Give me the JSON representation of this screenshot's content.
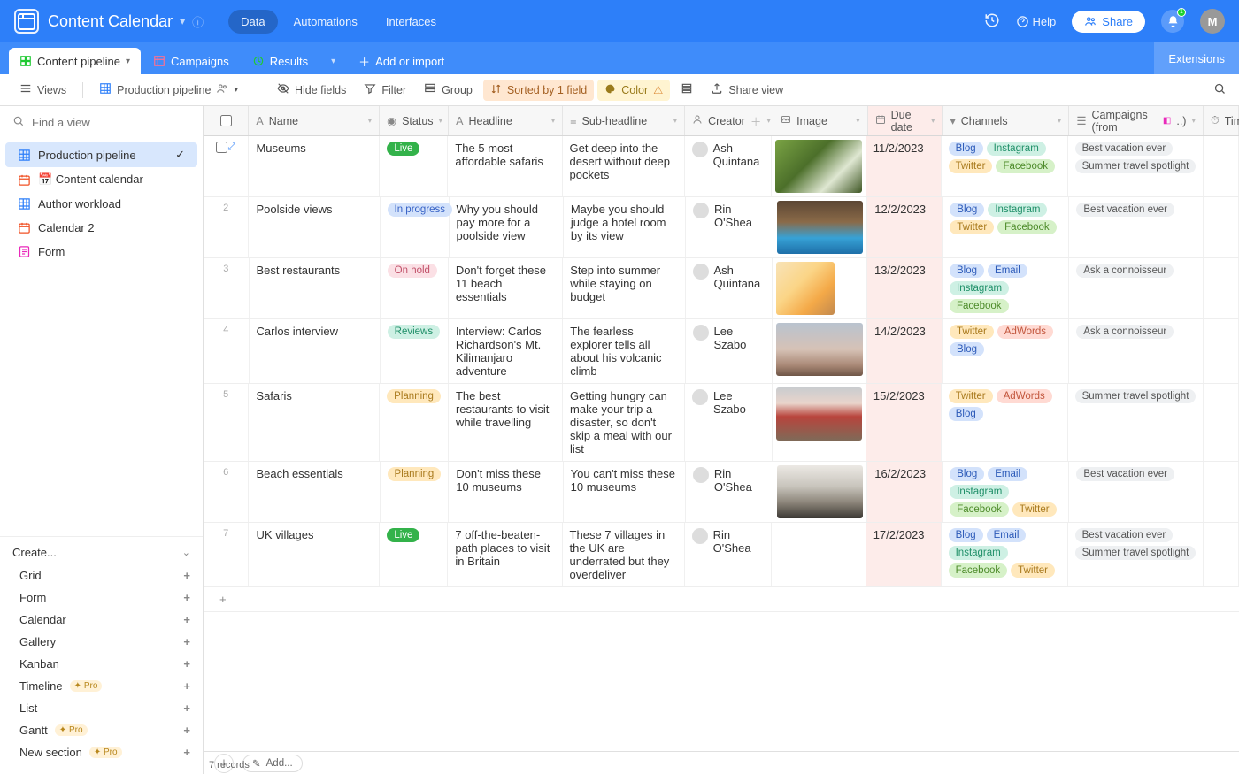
{
  "topbar": {
    "title": "Content Calendar",
    "tabs": {
      "data": "Data",
      "automations": "Automations",
      "interfaces": "Interfaces"
    },
    "help": "Help",
    "share": "Share",
    "avatar": "M",
    "notif_count": "1"
  },
  "tables": {
    "pipeline": "Content pipeline",
    "campaigns": "Campaigns",
    "results": "Results",
    "add": "Add or import",
    "extensions": "Extensions"
  },
  "toolbar": {
    "views": "Views",
    "currentView": "Production pipeline",
    "hide": "Hide fields",
    "filter": "Filter",
    "group": "Group",
    "sorted": "Sorted by 1 field",
    "color": "Color",
    "shareview": "Share view"
  },
  "sidebar": {
    "searchPlaceholder": "Find a view",
    "views": [
      {
        "label": "Production pipeline",
        "type": "grid",
        "active": true
      },
      {
        "label": "📅 Content calendar",
        "type": "cal"
      },
      {
        "label": "Author workload",
        "type": "grid"
      },
      {
        "label": "Calendar 2",
        "type": "cal"
      },
      {
        "label": "Form",
        "type": "form"
      }
    ],
    "create": "Create...",
    "types": [
      {
        "label": "Grid",
        "icon": "grid"
      },
      {
        "label": "Form",
        "icon": "form"
      },
      {
        "label": "Calendar",
        "icon": "cal"
      },
      {
        "label": "Gallery",
        "icon": "gal"
      },
      {
        "label": "Kanban",
        "icon": "kan"
      },
      {
        "label": "Timeline",
        "icon": "tl",
        "pro": true
      },
      {
        "label": "List",
        "icon": "list"
      },
      {
        "label": "Gantt",
        "icon": "gantt",
        "pro": true
      },
      {
        "label": "New section",
        "icon": "",
        "pro": true
      }
    ],
    "proLabel": "Pro"
  },
  "columns": {
    "name": "Name",
    "status": "Status",
    "headline": "Headline",
    "sub": "Sub-headline",
    "creator": "Creator",
    "image": "Image",
    "due": "Due date",
    "channels": "Channels",
    "campaigns": "Campaigns (from",
    "time": "Time"
  },
  "rows": [
    {
      "n": "",
      "name": "Museums",
      "status": "Live",
      "stClass": "st-live",
      "headline": "The 5 most affordable safaris",
      "sub": "Get deep into the desert without deep pockets",
      "creator": "Ash Quintana",
      "img": "img-safari",
      "due": "11/2/2023",
      "channels": [
        "Blog",
        "Instagram",
        "Twitter",
        "Facebook"
      ],
      "campaigns": [
        "Best vacation ever",
        "Summer travel spotlight"
      ]
    },
    {
      "n": "2",
      "name": "Poolside views",
      "status": "In progress",
      "stClass": "st-progress",
      "headline": "Why you should pay more for a poolside view",
      "sub": "Maybe you should judge a hotel room by its view",
      "creator": "Rin O'Shea",
      "img": "img-pool",
      "due": "12/2/2023",
      "channels": [
        "Blog",
        "Instagram",
        "Twitter",
        "Facebook"
      ],
      "campaigns": [
        "Best vacation ever"
      ]
    },
    {
      "n": "3",
      "name": "Best restaurants",
      "status": "On hold",
      "stClass": "st-hold",
      "headline": "Don't forget these 11 beach essentials",
      "sub": "Step into summer while staying on budget",
      "creator": "Ash Quintana",
      "img": "img-beach",
      "due": "13/2/2023",
      "channels": [
        "Blog",
        "Email",
        "Instagram",
        "Facebook"
      ],
      "campaigns": [
        "Ask a connoisseur"
      ]
    },
    {
      "n": "4",
      "name": "Carlos interview",
      "status": "Reviews",
      "stClass": "st-reviews",
      "headline": "Interview: Carlos Richardson's Mt. Kilimanjaro adventure",
      "sub": "The fearless explorer tells all about his volcanic climb",
      "creator": "Lee Szabo",
      "img": "img-mountain",
      "due": "14/2/2023",
      "channels": [
        "Twitter",
        "AdWords",
        "Blog"
      ],
      "campaigns": [
        "Ask a connoisseur"
      ]
    },
    {
      "n": "5",
      "name": "Safaris",
      "status": "Planning",
      "stClass": "st-planning",
      "headline": "The best restaurants to visit while travelling",
      "sub": "Getting hungry can make your trip a disaster, so don't skip a meal with our list",
      "creator": "Lee Szabo",
      "img": "img-rest",
      "due": "15/2/2023",
      "channels": [
        "Twitter",
        "AdWords",
        "Blog"
      ],
      "campaigns": [
        "Summer travel spotlight"
      ]
    },
    {
      "n": "6",
      "name": "Beach essentials",
      "status": "Planning",
      "stClass": "st-planning",
      "headline": "Don't miss these 10 museums",
      "sub": "You can't miss these 10 museums",
      "creator": "Rin O'Shea",
      "img": "img-museum",
      "due": "16/2/2023",
      "channels": [
        "Blog",
        "Email",
        "Instagram",
        "Facebook",
        "Twitter"
      ],
      "campaigns": [
        "Best vacation ever"
      ]
    },
    {
      "n": "7",
      "name": "UK villages",
      "status": "Live",
      "stClass": "st-live",
      "headline": "7 off-the-beaten-path places to visit in Britain",
      "sub": "These 7 villages in the UK are underrated but they overdeliver",
      "creator": "Rin O'Shea",
      "img": "",
      "due": "17/2/2023",
      "channels": [
        "Blog",
        "Email",
        "Instagram",
        "Facebook",
        "Twitter"
      ],
      "campaigns": [
        "Best vacation ever",
        "Summer travel spotlight"
      ]
    }
  ],
  "channelClass": {
    "Blog": "ch-blog",
    "Instagram": "ch-instagram",
    "Twitter": "ch-twitter",
    "Facebook": "ch-facebook",
    "Email": "ch-email",
    "AdWords": "ch-adwords"
  },
  "footer": {
    "add": "Add...",
    "records": "7 records"
  }
}
